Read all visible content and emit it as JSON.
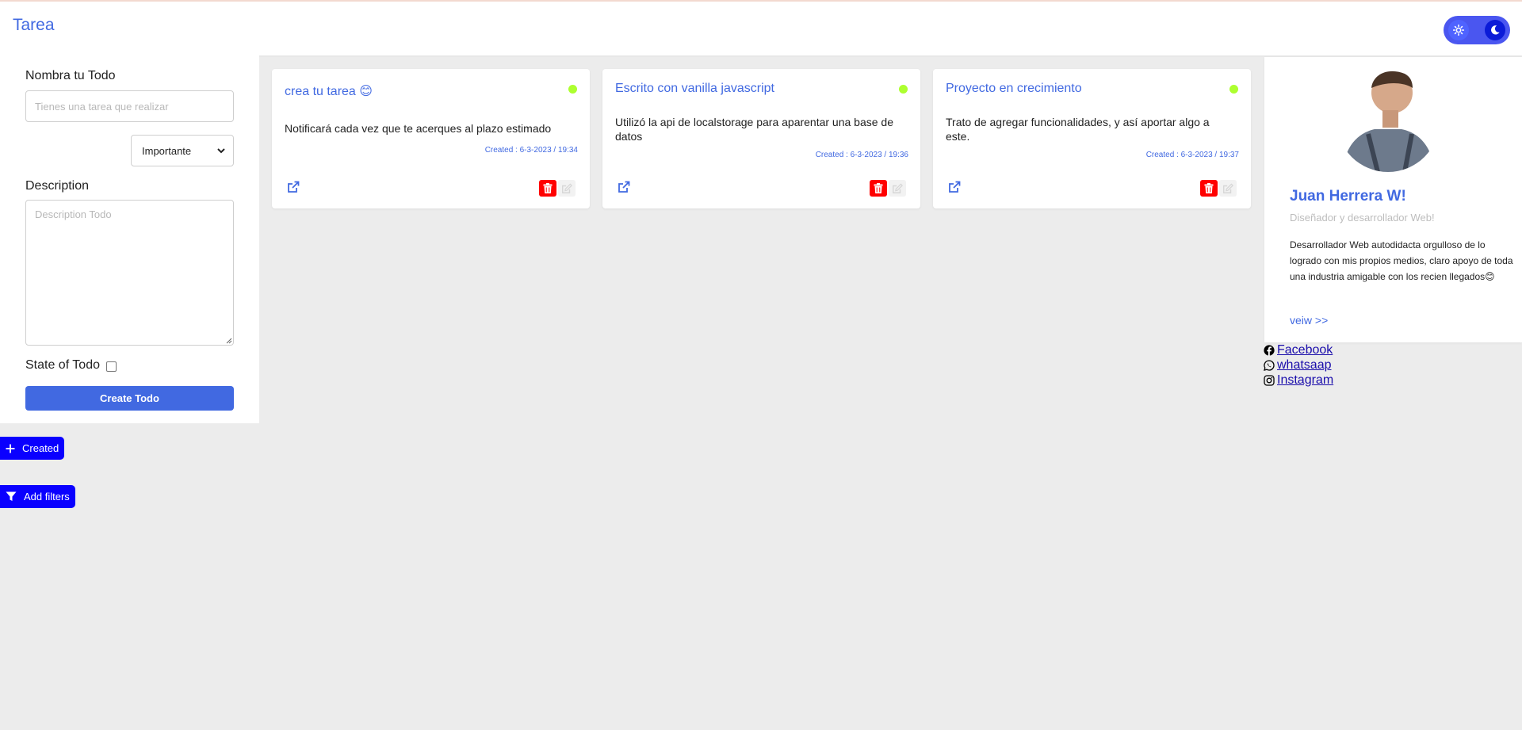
{
  "header": {
    "brand": "Tarea",
    "theme_toggle": {
      "light_icon": "sun-icon",
      "dark_icon": "moon-icon"
    }
  },
  "form": {
    "name_label": "Nombra tu Todo",
    "name_placeholder": "Tienes una tarea que realizar",
    "priority_selected": "Importante",
    "description_label": "Description",
    "description_placeholder": "Description Todo",
    "state_label": "State of Todo",
    "state_checked": false,
    "create_label": "Create Todo"
  },
  "cards": [
    {
      "title": "crea tu tarea 😊",
      "description": "Notificará cada vez que te acerques al plazo estimado",
      "created": "Created : 6-3-2023 / 19:34",
      "status_color": "#adff2f"
    },
    {
      "title": "Escrito con vanilla javascript",
      "description": "Utilizó la api de localstorage para aparentar una base de datos",
      "created": "Created : 6-3-2023 / 19:36",
      "status_color": "#adff2f"
    },
    {
      "title": "Proyecto en crecimiento",
      "description": "Trato de agregar funcionalidades, y así aportar algo a este.",
      "created": "Created : 6-3-2023 / 19:37",
      "status_color": "#adff2f"
    }
  ],
  "profile": {
    "name": "Juan Herrera W!",
    "role": "Diseñador y desarrollador Web!",
    "bio": "Desarrollador Web autodidacta orgulloso de lo logrado con mis propios medios, claro apoyo de toda una industria amigable con los recien llegados😊",
    "view_link": "veiw >>"
  },
  "social": [
    {
      "label": "Facebook",
      "icon": "facebook-icon"
    },
    {
      "label": "whatsaap",
      "icon": "whatsapp-icon"
    },
    {
      "label": "Instagram",
      "icon": "instagram-icon"
    }
  ],
  "actions": {
    "created_label": "Created",
    "filters_label": "Add filters"
  },
  "colors": {
    "accent": "#4169e1",
    "danger": "#ff0000",
    "status": "#adff2f",
    "action_blue": "#0a00ff",
    "background": "#ececec"
  }
}
